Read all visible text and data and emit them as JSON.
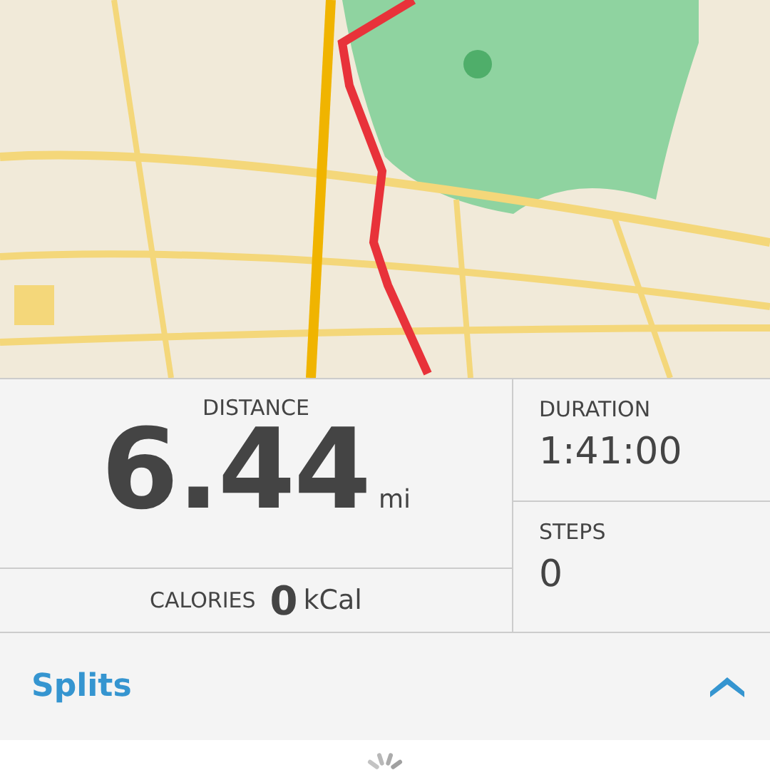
{
  "distance": {
    "label": "DISTANCE",
    "value": "6.44",
    "unit": "mi"
  },
  "calories": {
    "label": "CALORIES",
    "value": "0",
    "unit": "kCal"
  },
  "duration": {
    "label": "DURATION",
    "value": "1:41:00"
  },
  "steps": {
    "label": "STEPS",
    "value": "0"
  },
  "splits": {
    "label": "Splits",
    "expanded": true
  },
  "loading": true
}
